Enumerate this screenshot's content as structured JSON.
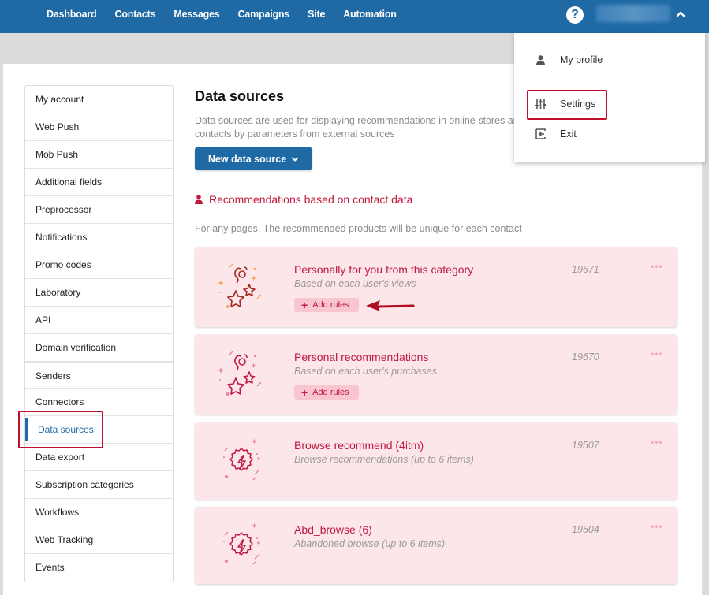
{
  "topbar": {
    "nav": [
      "Dashboard",
      "Contacts",
      "Messages",
      "Campaigns",
      "Site",
      "Automation"
    ],
    "help_icon": "question-circle-icon",
    "user_menu_icon": "chevron-up-icon"
  },
  "user_dropdown": {
    "items": [
      {
        "label": "My profile",
        "icon": "user-icon"
      },
      {
        "label": "Settings",
        "icon": "sliders-icon",
        "highlighted": true
      },
      {
        "label": "Exit",
        "icon": "exit-icon"
      }
    ]
  },
  "sidebar": {
    "items": [
      {
        "label": "My account"
      },
      {
        "label": "Web Push"
      },
      {
        "label": "Mob Push"
      },
      {
        "label": "Additional fields"
      },
      {
        "label": "Preprocessor"
      },
      {
        "label": "Notifications"
      },
      {
        "label": "Promo codes"
      },
      {
        "label": "Laboratory"
      },
      {
        "label": "API"
      },
      {
        "label": "Domain verification"
      },
      {
        "label": "Senders"
      },
      {
        "label": "Connectors"
      },
      {
        "label": "Data sources",
        "active": true
      },
      {
        "label": "Data export"
      },
      {
        "label": "Subscription categories"
      },
      {
        "label": "Workflows"
      },
      {
        "label": "Web Tracking"
      },
      {
        "label": "Events"
      }
    ]
  },
  "main": {
    "title": "Data sources",
    "description": "Data sources are used for displaying recommendations in online stores and contacts by parameters from external sources",
    "new_button": "New data source",
    "section": {
      "title": "Recommendations based on contact data",
      "description": "For any pages. The recommended products will be unique for each contact"
    },
    "add_rules_label": "Add rules",
    "more_label": "•••",
    "cards": [
      {
        "title": "Personally for you from this category",
        "subtitle": "Based on each user's views",
        "id": "19671",
        "icon": "stars-person-icon",
        "has_rules": true
      },
      {
        "title": "Personal recommendations",
        "subtitle": "Based on each user's purchases",
        "id": "19670",
        "icon": "stars-person-icon",
        "has_rules": true
      },
      {
        "title": "Browse recommend (4itm)",
        "subtitle": "Browse recommendations (up to 6 items)",
        "id": "19507",
        "icon": "lightning-badge-icon",
        "has_rules": false
      },
      {
        "title": "Abd_browse (6)",
        "subtitle": "Abandoned browse (up to 6 items)",
        "id": "19504",
        "icon": "lightning-badge-icon",
        "has_rules": false
      }
    ]
  },
  "colors": {
    "brand_blue": "#1f6aa5",
    "accent_red": "#c0193f",
    "card_bg": "#fde6ea",
    "highlight_box": "#c0102b"
  }
}
